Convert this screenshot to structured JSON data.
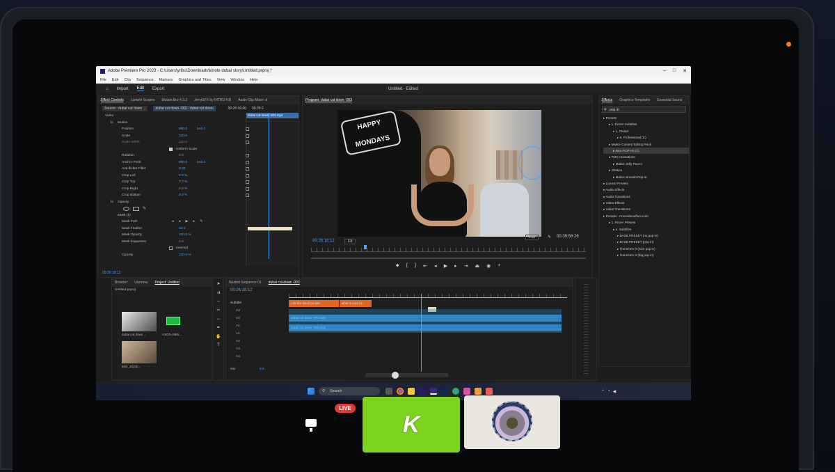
{
  "window": {
    "title": "Adobe Premiere Pro 2023 - C:\\Users\\yrlbu\\Downloads\\kinote dubai story\\Untitled.prproj *",
    "menu": [
      "File",
      "Edit",
      "Clip",
      "Sequence",
      "Markers",
      "Graphics and Titles",
      "View",
      "Window",
      "Help"
    ],
    "controls": [
      "–",
      "□",
      "✕"
    ]
  },
  "appbar": {
    "tabs": [
      "Import",
      "Edit",
      "Export"
    ],
    "active_tab": "Edit",
    "project_title": "Untitled - Edited"
  },
  "effect_controls": {
    "tabs": [
      "Effect Controls",
      "Lumetri Scopes",
      "Motion Bro 4.3.2",
      "JerrySFX by INTRO HD",
      "Audio Clip Mixer: d"
    ],
    "source_label": "Source - dubai cut down ...",
    "clip_label": "dubai cut down -003 - dubai cut down",
    "tc_start": "00:26:16:00",
    "tc_end": "00:26:2",
    "clip_name": "dubai cut down -003.mp4",
    "sections": {
      "video": "Video",
      "motion": "Motion",
      "opacity": "Opacity"
    },
    "rows": [
      {
        "label": "Position",
        "v1": "960.0",
        "v2": "540.0"
      },
      {
        "label": "Scale",
        "v1": "100.0",
        "v2": ""
      },
      {
        "label": "Scale Width",
        "v1": "100.0",
        "v2": ""
      },
      {
        "label": "Uniform Scale",
        "v1": "",
        "v2": ""
      },
      {
        "label": "Rotation",
        "v1": "0.0",
        "v2": ""
      },
      {
        "label": "Anchor Point",
        "v1": "960.0",
        "v2": "540.0"
      },
      {
        "label": "Anti-flicker Filter",
        "v1": "0.00",
        "v2": ""
      },
      {
        "label": "Crop Left",
        "v1": "0.0 %",
        "v2": ""
      },
      {
        "label": "Crop Top",
        "v1": "0.0 %",
        "v2": ""
      },
      {
        "label": "Crop Right",
        "v1": "0.0 %",
        "v2": ""
      },
      {
        "label": "Crop Bottom",
        "v1": "0.0 %",
        "v2": ""
      }
    ],
    "mask": {
      "name": "Mask (1)",
      "path": "Mask Path",
      "feather": "Mask Feather",
      "feather_val": "10.0",
      "opacity": "Mask Opacity",
      "opacity_val": "100.0 %",
      "expansion": "Mask Expansion",
      "expansion_val": "0.0",
      "inverted": "Inverted"
    },
    "opacity_row": {
      "label": "Opacity",
      "val": "100.0 %"
    },
    "bottom_tc": "00:26:18:12"
  },
  "program": {
    "title": "Program: dubai cut down -003",
    "timecode": "00:26:18:12",
    "fit": "Fit",
    "quality": "Full",
    "duration": "00:39:56:26",
    "shirt_text": "HAPPY MONDAYS"
  },
  "effects": {
    "tabs": [
      "Effects",
      "Graphics Templates",
      "Essential Sound"
    ],
    "search": "pop in",
    "tree": [
      "Presets",
      "1. Finzer Subtitles",
      "1. Center",
      "5. Professional (C)",
      "Malice Content Editing Pack",
      "Nice POP-IN (C)",
      "FMG Animations",
      "Malice Jelly Pop In",
      "Shakes",
      "Malice Smooth Pop In",
      "Lumetri Presets",
      "Audio Effects",
      "Audio Transitions",
      "Video Effects",
      "Video Transitions",
      "Presets - Freevideoeffect.com",
      "1. Finzer Presets",
      "4. Subtitles",
      "BASE PRESET (no pop in)",
      "BASE PRESET (pop in)",
      "Transform 0 (nice pop in)",
      "Transform 2 (big pop in)"
    ]
  },
  "project": {
    "tabs": [
      "Browser",
      "Libraries",
      "Project: Untitled"
    ],
    "file": "Untitled.prproj",
    "items": [
      {
        "name": "dubai cut down ...",
        "dur": "4:29"
      },
      {
        "name": "AXON 4985...",
        "dur": "37:39:00"
      },
      {
        "name": "IMG_20230...",
        "dur": "4:29"
      }
    ]
  },
  "timeline": {
    "tabs": [
      "Nested Sequence 01",
      "dubai cut down -003"
    ],
    "timecode": "00:26:18:12",
    "subtitle_track": "Subtitle",
    "captions": [
      "i do like black people",
      "what is your pr..."
    ],
    "v_clip_top": "dubai cut down -003.mp4",
    "v_clip_bottom": "dubai cut down -003.mp4",
    "tracks": [
      "V3",
      "V2",
      "V1",
      "A1",
      "A2",
      "A3",
      "A4"
    ],
    "master": "Mix",
    "master_val": "0.0"
  },
  "taskbar": {
    "search": "Search"
  },
  "overlay": {
    "live": "LIVE",
    "k_letter": "K"
  }
}
